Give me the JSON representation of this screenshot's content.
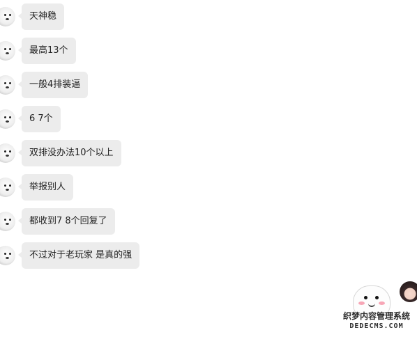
{
  "messages": [
    {
      "text": "天神稳"
    },
    {
      "text": "最高13个"
    },
    {
      "text": "一般4排装逼"
    },
    {
      "text": "6 7个"
    },
    {
      "text": "双排没办法10个以上"
    },
    {
      "text": "举报别人"
    },
    {
      "text": "都收到7 8个回复了"
    },
    {
      "text": "不过对于老玩家 是真的强"
    }
  ],
  "watermark": {
    "cn": "织梦内容管理系统",
    "en": "DEDECMS.COM"
  }
}
